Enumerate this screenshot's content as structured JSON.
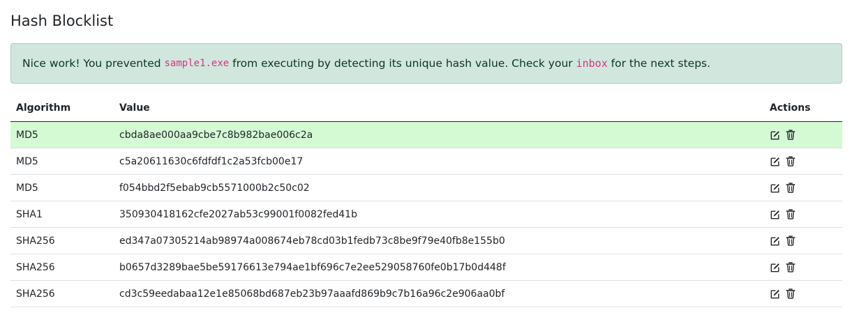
{
  "page": {
    "title": "Hash Blocklist"
  },
  "alert": {
    "text_before": "Nice work! You prevented ",
    "filename": "sample1.exe",
    "text_middle": " from executing by detecting its unique hash value. Check your ",
    "link_text": "inbox",
    "text_after": " for the next steps."
  },
  "table": {
    "headers": {
      "algorithm": "Algorithm",
      "value": "Value",
      "actions": "Actions"
    },
    "rows": [
      {
        "algorithm": "MD5",
        "value": "cbda8ae000aa9cbe7c8b982bae006c2a",
        "highlighted": true
      },
      {
        "algorithm": "MD5",
        "value": "c5a20611630c6fdfdf1c2a53fcb00e17",
        "highlighted": false
      },
      {
        "algorithm": "MD5",
        "value": "f054bbd2f5ebab9cb5571000b2c50c02",
        "highlighted": false
      },
      {
        "algorithm": "SHA1",
        "value": "350930418162cfe2027ab53c99001f0082fed41b",
        "highlighted": false
      },
      {
        "algorithm": "SHA256",
        "value": "ed347a07305214ab98974a008674eb78cd03b1fedb73c8be9f79e40fb8e155b0",
        "highlighted": false
      },
      {
        "algorithm": "SHA256",
        "value": "b0657d3289bae5be59176613e794ae1bf696c7e2ee529058760fe0b17b0d448f",
        "highlighted": false
      },
      {
        "algorithm": "SHA256",
        "value": "cd3c59eedabaa12e1e85068bd687eb23b97aaafd869b9c7b16a96c2e906aa0bf",
        "highlighted": false
      }
    ]
  },
  "icons": {
    "edit": "edit-icon",
    "delete": "trash-icon"
  },
  "colors": {
    "alert_bg": "#d1e7dd",
    "alert_border": "#a3cfbb",
    "alert_text": "#0a3622",
    "code_pink": "#d63384",
    "highlight_row": "#d4fad4"
  }
}
